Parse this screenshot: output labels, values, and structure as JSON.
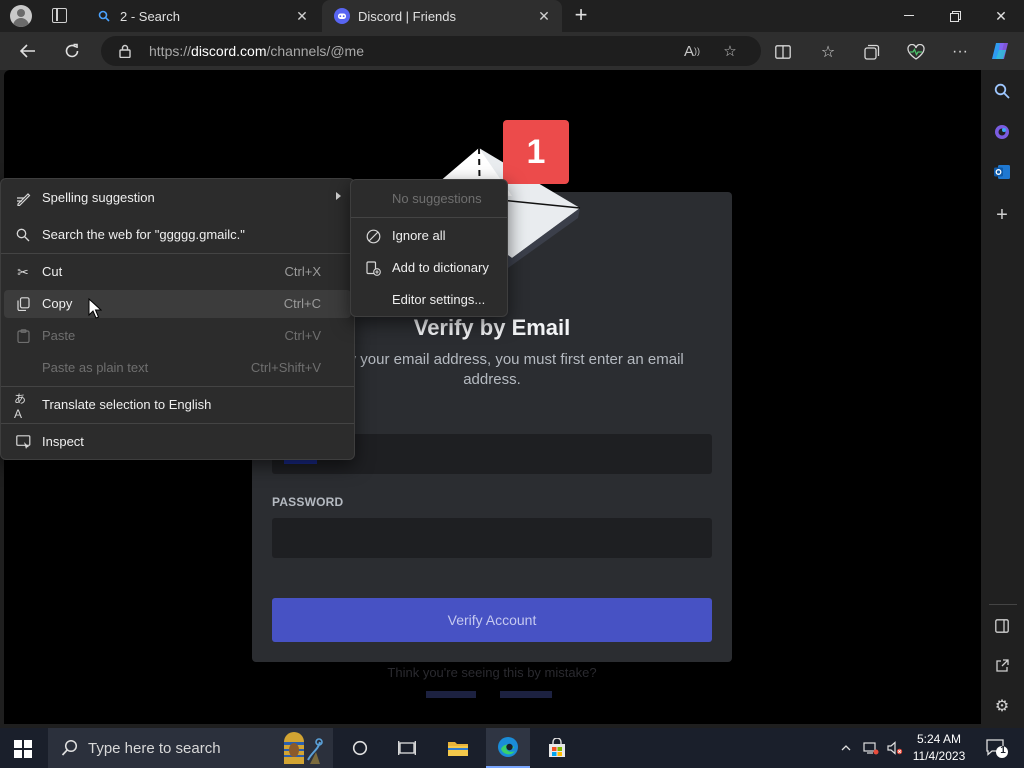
{
  "browser": {
    "tabs": [
      {
        "label": "2 - Search"
      },
      {
        "label": "Discord | Friends"
      }
    ],
    "url_prefix": "https://",
    "url_domain": "discord.com",
    "url_path": "/channels/@me"
  },
  "page": {
    "badge_number": "1",
    "heading": "Verify by Email",
    "description": "To verify your email address, you must first enter an email address.",
    "email_value": "ggggg.gmailc.",
    "email_visible_selected": "ailc.",
    "password_label": "PASSWORD",
    "submit_label": "Verify Account",
    "footer_text": "Think you're seeing this by mistake?"
  },
  "context_menu": {
    "items": [
      {
        "label": "Spelling suggestion",
        "shortcut": ""
      },
      {
        "label": "Search the web for \"ggggg.gmailc.\"",
        "shortcut": ""
      },
      {
        "label": "Cut",
        "shortcut": "Ctrl+X"
      },
      {
        "label": "Copy",
        "shortcut": "Ctrl+C"
      },
      {
        "label": "Paste",
        "shortcut": "Ctrl+V"
      },
      {
        "label": "Paste as plain text",
        "shortcut": "Ctrl+Shift+V"
      },
      {
        "label": "Translate selection to English",
        "shortcut": ""
      },
      {
        "label": "Inspect",
        "shortcut": ""
      }
    ],
    "submenu": [
      {
        "label": "No suggestions"
      },
      {
        "label": "Ignore all"
      },
      {
        "label": "Add to dictionary"
      },
      {
        "label": "Editor settings..."
      }
    ]
  },
  "taskbar": {
    "search_placeholder": "Type here to search",
    "time": "5:24 AM",
    "date": "11/4/2023",
    "notification_count": "1"
  },
  "colors": {
    "accent": "#5865f2",
    "badge": "#ec4b4b",
    "selection": "#1a2a8a"
  }
}
